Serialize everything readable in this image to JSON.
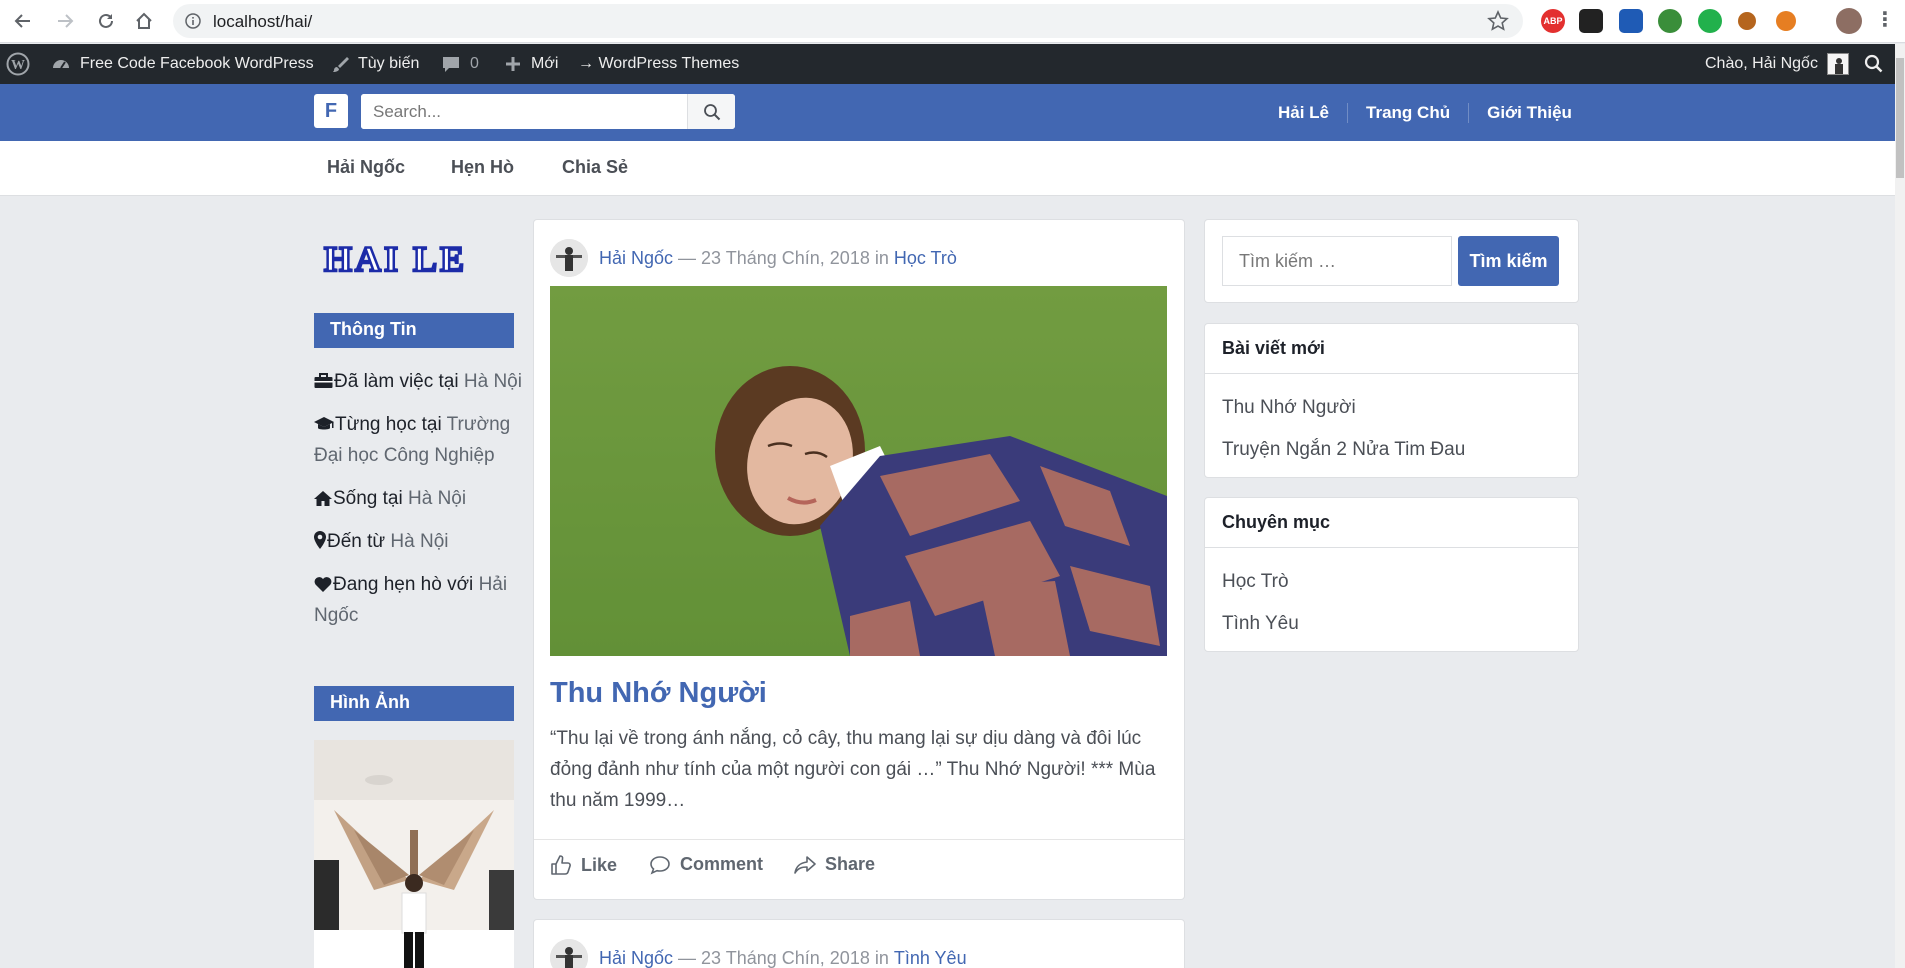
{
  "browser": {
    "url": "localhost/hai/",
    "extensions": [
      "abp-icon",
      "ext-icon",
      "ext-icon",
      "ext-icon",
      "ext-icon",
      "ext-icon",
      "ext-icon"
    ],
    "abp_label": "ABP"
  },
  "admin_bar": {
    "site_name": "Free Code Facebook WordPress",
    "customize": "Tùy biến",
    "comments_count": "0",
    "new": "Mới",
    "themes": "→ WordPress Themes",
    "greeting": "Chào, Hải Ngốc"
  },
  "header": {
    "logo": "F",
    "search_placeholder": "Search...",
    "nav": [
      "Hải Lê",
      "Trang Chủ",
      "Giới Thiệu"
    ]
  },
  "sub_nav": [
    "Hải Ngốc",
    "Hẹn Hò",
    "Chia Sẻ"
  ],
  "left_sidebar": {
    "logo_text": "HAI LE",
    "info_title": "Thông Tin",
    "info": [
      {
        "icon": "briefcase-icon",
        "text": "Đã làm việc tại ",
        "link": "Hà Nội"
      },
      {
        "icon": "graduation-cap-icon",
        "text": "Từng học tại ",
        "link": "Trường Đại học Công Nghiệp"
      },
      {
        "icon": "home-icon",
        "text": "Sống tại ",
        "link": "Hà Nội"
      },
      {
        "icon": "map-marker-icon",
        "text": "Đến từ ",
        "link": "Hà Nội"
      },
      {
        "icon": "heart-icon",
        "text": "Đang hẹn hò với ",
        "link": "Hải Ngốc"
      }
    ],
    "photos_title": "Hình Ảnh"
  },
  "posts": [
    {
      "author": "Hải Ngốc",
      "date": "— 23 Tháng Chín, 2018 in",
      "category": "Học Trò",
      "title": "Thu Nhớ Người",
      "excerpt": "“Thu lại về trong ánh nắng, cỏ cây, thu mang lại sự dịu dàng và đôi lúc đỏng đảnh như tính của một người con gái …” Thu Nhớ Người! *** Mùa thu năm 1999…",
      "actions": {
        "like": "Like",
        "comment": "Comment",
        "share": "Share"
      }
    },
    {
      "author": "Hải Ngốc",
      "date": "— 23 Tháng Chín, 2018 in",
      "category": "Tình Yêu"
    }
  ],
  "right_sidebar": {
    "search_placeholder": "Tìm kiếm …",
    "search_button": "Tìm kiếm",
    "recent_title": "Bài viết mới",
    "recent": [
      "Thu Nhớ Người",
      "Truyện Ngắn 2 Nửa Tim Đau"
    ],
    "categories_title": "Chuyên mục",
    "categories": [
      "Học Trò",
      "Tình Yêu"
    ]
  },
  "colors": {
    "brand": "#4267b2",
    "admin_bar": "#23282d",
    "page_bg": "#e9ebee"
  }
}
